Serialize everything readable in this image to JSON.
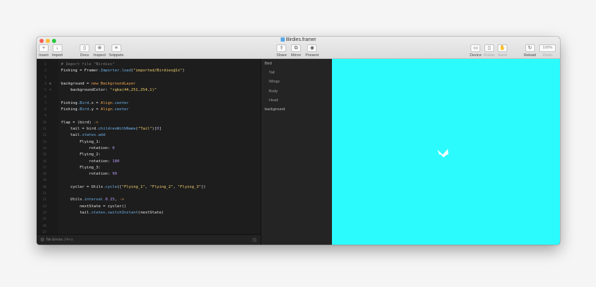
{
  "window": {
    "title": "Birdies.framer"
  },
  "toolbar": {
    "insert": "Insert",
    "import": "Import",
    "docs": "Docs",
    "inspect": "Inspect",
    "snippets": "Snippets",
    "share": "Share",
    "mirror": "Mirror",
    "present": "Present",
    "device": "Device",
    "rotate": "Rotate",
    "hand": "Hand",
    "reload": "Reload",
    "zoom_value": "100%",
    "zoom": "Zoom"
  },
  "editor": {
    "lines": [
      {
        "n": "1",
        "t": "# Import file \"Birdies\""
      },
      {
        "n": "2",
        "t": "Fishing = Framer.Importer.load(\"imported/Birdies@1x\")"
      },
      {
        "n": "3",
        "t": ""
      },
      {
        "n": "4",
        "t": "background = new BackgroundLayer"
      },
      {
        "n": "5",
        "t": "    backgroundColor: \"rgba(44,251,254,1)\""
      },
      {
        "n": "6",
        "t": ""
      },
      {
        "n": "7",
        "t": "Fishing.Bird.x = Align.center"
      },
      {
        "n": "8",
        "t": "Fishing.Bird.y = Align.center"
      },
      {
        "n": "9",
        "t": ""
      },
      {
        "n": "10",
        "t": "flap = (bird) ->"
      },
      {
        "n": "11",
        "t": "    tail = bird.childrenWithName(\"Tail\")[0]"
      },
      {
        "n": "12",
        "t": "    tail.states.add"
      },
      {
        "n": "13",
        "t": "        Flying_1:"
      },
      {
        "n": "14",
        "t": "            rotation: 0"
      },
      {
        "n": "15",
        "t": "        Flying_2:"
      },
      {
        "n": "16",
        "t": "            rotation: 180"
      },
      {
        "n": "17",
        "t": "        Flying_3:"
      },
      {
        "n": "18",
        "t": "            rotation: 90"
      },
      {
        "n": "19",
        "t": ""
      },
      {
        "n": "20",
        "t": "    cycler = Utils.cycle([\"Flying_1\", \"Flying_2\", \"Flying_3\"])"
      },
      {
        "n": "21",
        "t": ""
      },
      {
        "n": "22",
        "t": "    Utils.interval 0.15, ->"
      },
      {
        "n": "23",
        "t": "        nextState = cycler()"
      },
      {
        "n": "24",
        "t": "        tail.states.switchInstant(nextState)"
      },
      {
        "n": "25",
        "t": ""
      },
      {
        "n": "26",
        "t": ""
      },
      {
        "n": "27",
        "t": ""
      }
    ]
  },
  "status": {
    "text": "No Errors",
    "time": "24ms"
  },
  "layers": [
    {
      "name": "Bird",
      "child": false
    },
    {
      "name": "Tail",
      "child": true
    },
    {
      "name": "Wings",
      "child": true
    },
    {
      "name": "Body",
      "child": true
    },
    {
      "name": "Head",
      "child": true
    },
    {
      "name": "background",
      "child": false
    }
  ],
  "preview": {
    "background": "#2cfbfe"
  }
}
